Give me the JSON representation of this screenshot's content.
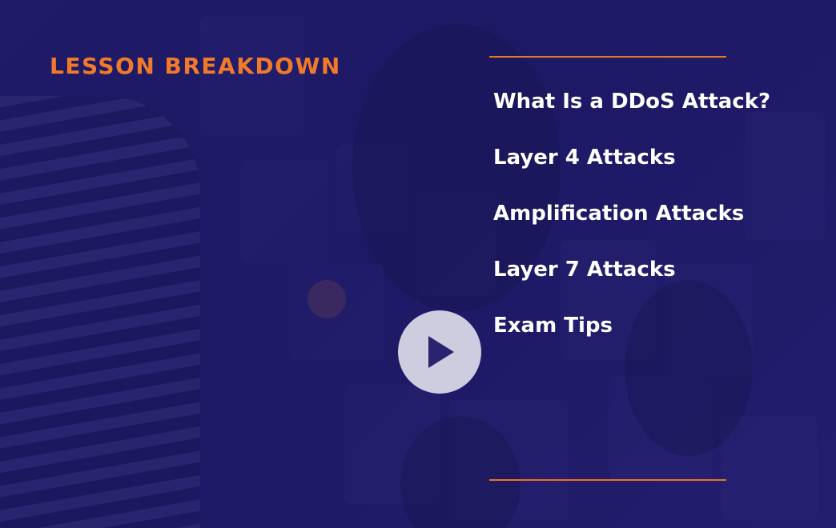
{
  "lesson": {
    "heading": "LESSON BREAKDOWN",
    "topics": [
      {
        "label": "What Is a DDoS Attack?"
      },
      {
        "label": "Layer 4 Attacks"
      },
      {
        "label": "Amplification Attacks"
      },
      {
        "label": "Layer 7 Attacks"
      },
      {
        "label": "Exam Tips"
      }
    ]
  },
  "player": {
    "play_icon": "play-icon"
  },
  "colors": {
    "background": "#1e1a5e",
    "accent": "#f07a2a",
    "text": "#ffffff",
    "play_button": "#e6e6f0"
  }
}
